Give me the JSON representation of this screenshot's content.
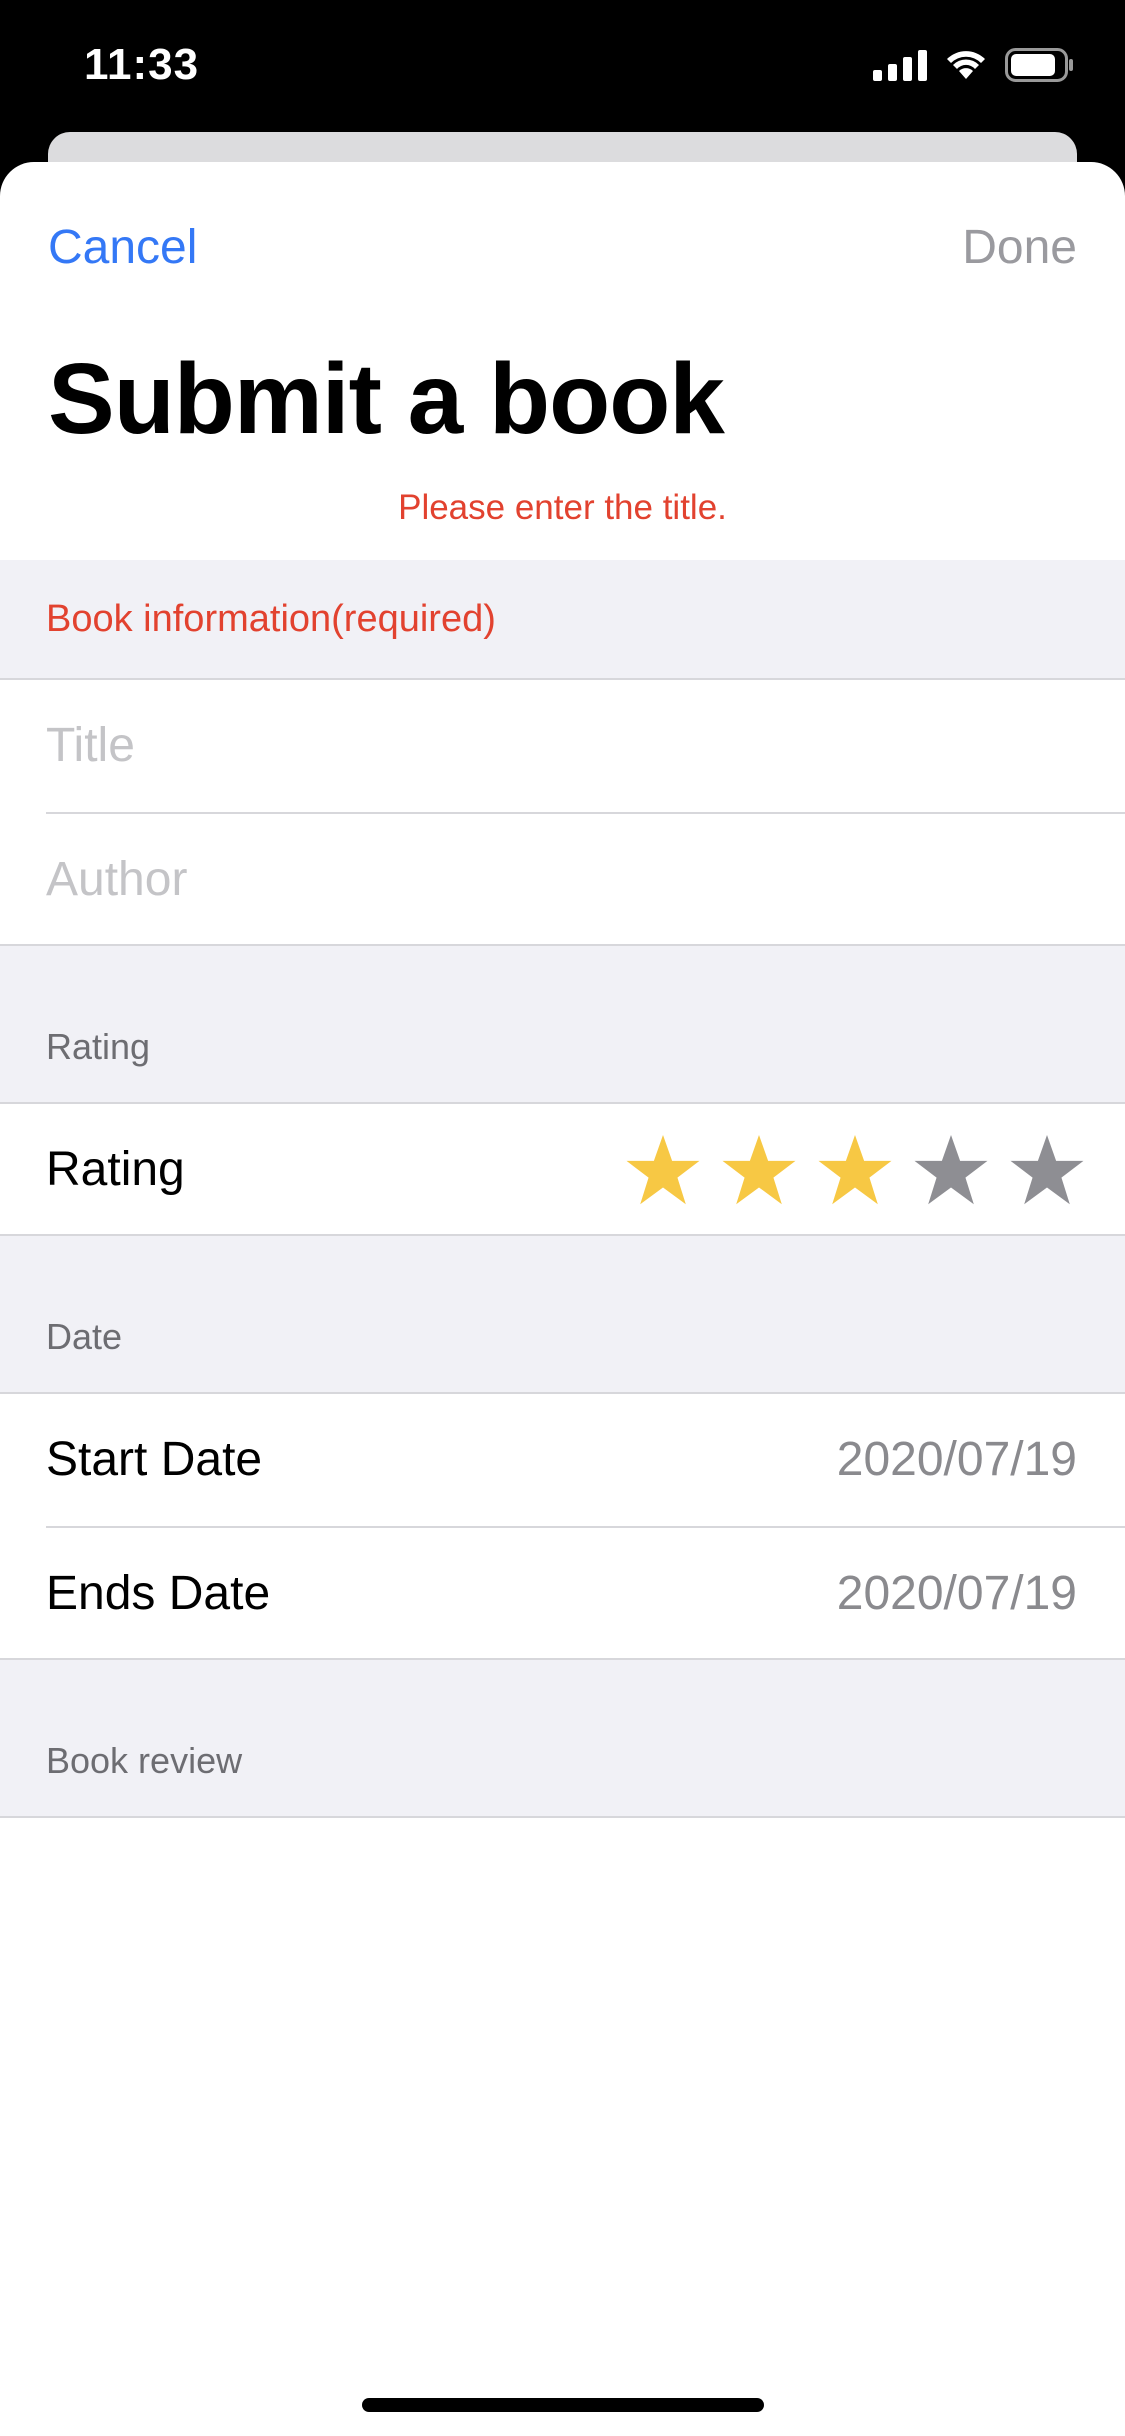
{
  "status_bar": {
    "time": "11:33",
    "icons": [
      "cellular-signal-icon",
      "wifi-icon",
      "battery-icon"
    ]
  },
  "nav": {
    "cancel_label": "Cancel",
    "done_label": "Done"
  },
  "page": {
    "title": "Submit a book",
    "error_message": "Please enter the title."
  },
  "sections": {
    "book_info": {
      "header": "Book information(required)",
      "title_placeholder": "Title",
      "author_placeholder": "Author"
    },
    "rating": {
      "header": "Rating",
      "label": "Rating",
      "value": 3,
      "max": 5
    },
    "date": {
      "header": "Date",
      "start_label": "Start Date",
      "start_value": "2020/07/19",
      "end_label": "Ends Date",
      "end_value": "2020/07/19"
    },
    "review": {
      "header": "Book review"
    }
  },
  "colors": {
    "accent": "#3478f6",
    "error": "#e2422f",
    "star_filled": "#f7c844",
    "star_empty": "#8e8e93",
    "group_background": "#f1f1f6"
  }
}
